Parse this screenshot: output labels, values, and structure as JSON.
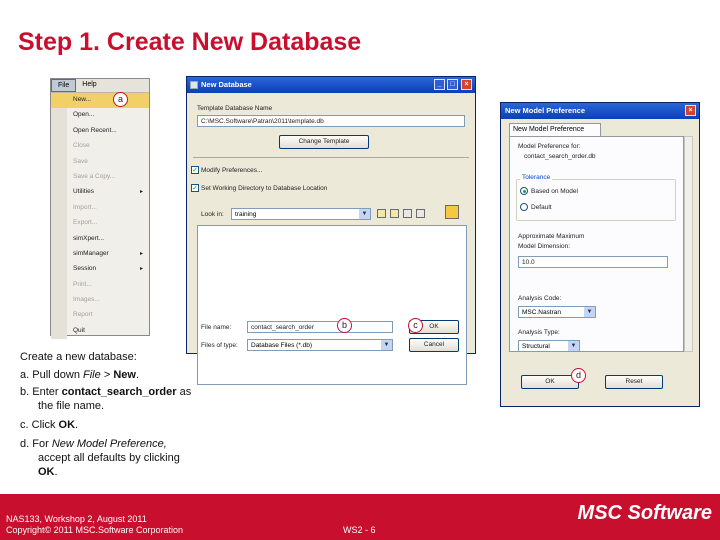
{
  "slide": {
    "title": "Step 1. Create New Database"
  },
  "file_menu": {
    "menubar": [
      "File",
      "Help"
    ],
    "items": [
      {
        "label": "New...",
        "state": "selected"
      },
      {
        "label": "Open...",
        "state": "enabled"
      },
      {
        "label": "Open Recent...",
        "state": "enabled"
      },
      {
        "label": "Close",
        "state": "disabled"
      },
      {
        "label": "Save",
        "state": "disabled"
      },
      {
        "label": "Save a Copy...",
        "state": "disabled"
      },
      {
        "label": "Utilities",
        "state": "enabled",
        "submenu": "▸"
      },
      {
        "label": "Import...",
        "state": "disabled"
      },
      {
        "label": "Export...",
        "state": "disabled"
      },
      {
        "label": "simXpert...",
        "state": "enabled"
      },
      {
        "label": "simManager",
        "state": "enabled",
        "submenu": "▸"
      },
      {
        "label": "Session",
        "state": "enabled",
        "submenu": "▸"
      },
      {
        "label": "Print...",
        "state": "disabled"
      },
      {
        "label": "Images...",
        "state": "disabled"
      },
      {
        "label": "Report",
        "state": "disabled"
      },
      {
        "label": "Quit",
        "state": "enabled"
      }
    ]
  },
  "new_database": {
    "title": "New Database",
    "template_label": "Template Database Name",
    "template_value": "C:\\MSC.Software\\Patran\\2011\\template.db",
    "change_template": "Change Template",
    "modify_preferences": "Modify Preferences...",
    "set_working_dir": "Set Working Directory to Database Location",
    "look_in_label": "Look in:",
    "look_in_value": "training",
    "file_name_label": "File name:",
    "file_name_value": "contact_search_order",
    "file_type_label": "Files of type:",
    "file_type_value": "Database Files (*.db)",
    "ok": "OK",
    "cancel": "Cancel"
  },
  "new_model_pref": {
    "title": "New Model Preference",
    "tab": "New Model Preference",
    "model_pref_for_label": "Model Preference for:",
    "model_pref_for_value": "contact_search_order.db",
    "tolerance_title": "Tolerance",
    "radio_based": "Based on Model",
    "radio_default": "Default",
    "approx_label_1": "Approximate Maximum",
    "approx_label_2": "Model Dimension:",
    "approx_value": "10.0",
    "analysis_code_label": "Analysis Code:",
    "analysis_code_value": "MSC.Nastran",
    "analysis_type_label": "Analysis Type:",
    "analysis_type_value": "Structural",
    "ok": "OK",
    "reset": "Reset"
  },
  "markers": {
    "a": "a",
    "b": "b",
    "c": "c",
    "d": "d"
  },
  "instructions": {
    "intro": "Create a new database:",
    "a_prefix": "a.",
    "a_text_1": "Pull down",
    "a_em": "File",
    "a_sep": ">",
    "a_bold": "New",
    "a_end": ".",
    "b_prefix": "b.",
    "b_text": "Enter",
    "b_bold": "contact_search_order",
    "b_end": "as the file name.",
    "c_prefix": "c.",
    "c_text": "Click",
    "c_bold": "OK",
    "c_end": ".",
    "d_prefix": "d.",
    "d_text": "For",
    "d_em": "New Model Preference,",
    "d_mid": "accept all defaults by clicking",
    "d_bold": "OK",
    "d_end": "."
  },
  "footer": {
    "line1": "NAS133, Workshop 2, August 2011",
    "line2": "Copyright© 2011 MSC.Software Corporation",
    "page": "WS2 - 6",
    "logo": "MSC Software"
  },
  "colors": {
    "accent": "#c8102e",
    "titlebar": "#0a3fb8"
  }
}
